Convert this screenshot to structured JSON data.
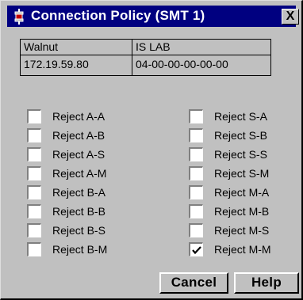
{
  "window": {
    "title": "Connection Policy (SMT 1)",
    "close_glyph": "X",
    "title_icon": "device-icon",
    "colors": {
      "titlebar": "#000080",
      "face": "#c0c0c0"
    }
  },
  "info": {
    "row1": {
      "name": "Walnut",
      "location": "IS LAB"
    },
    "row2": {
      "ip": "172.19.59.80",
      "mac": "04-00-00-00-00-00"
    }
  },
  "policies": {
    "left": [
      {
        "label": "Reject A-A",
        "checked": false
      },
      {
        "label": "Reject A-B",
        "checked": false
      },
      {
        "label": "Reject A-S",
        "checked": false
      },
      {
        "label": "Reject A-M",
        "checked": false
      },
      {
        "label": "Reject B-A",
        "checked": false
      },
      {
        "label": "Reject B-B",
        "checked": false
      },
      {
        "label": "Reject B-S",
        "checked": false
      },
      {
        "label": "Reject B-M",
        "checked": false
      }
    ],
    "right": [
      {
        "label": "Reject S-A",
        "checked": false
      },
      {
        "label": "Reject S-B",
        "checked": false
      },
      {
        "label": "Reject S-S",
        "checked": false
      },
      {
        "label": "Reject S-M",
        "checked": false
      },
      {
        "label": "Reject M-A",
        "checked": false
      },
      {
        "label": "Reject M-B",
        "checked": false
      },
      {
        "label": "Reject M-S",
        "checked": false
      },
      {
        "label": "Reject M-M",
        "checked": true
      }
    ]
  },
  "buttons": {
    "cancel": "Cancel",
    "help": "Help"
  }
}
